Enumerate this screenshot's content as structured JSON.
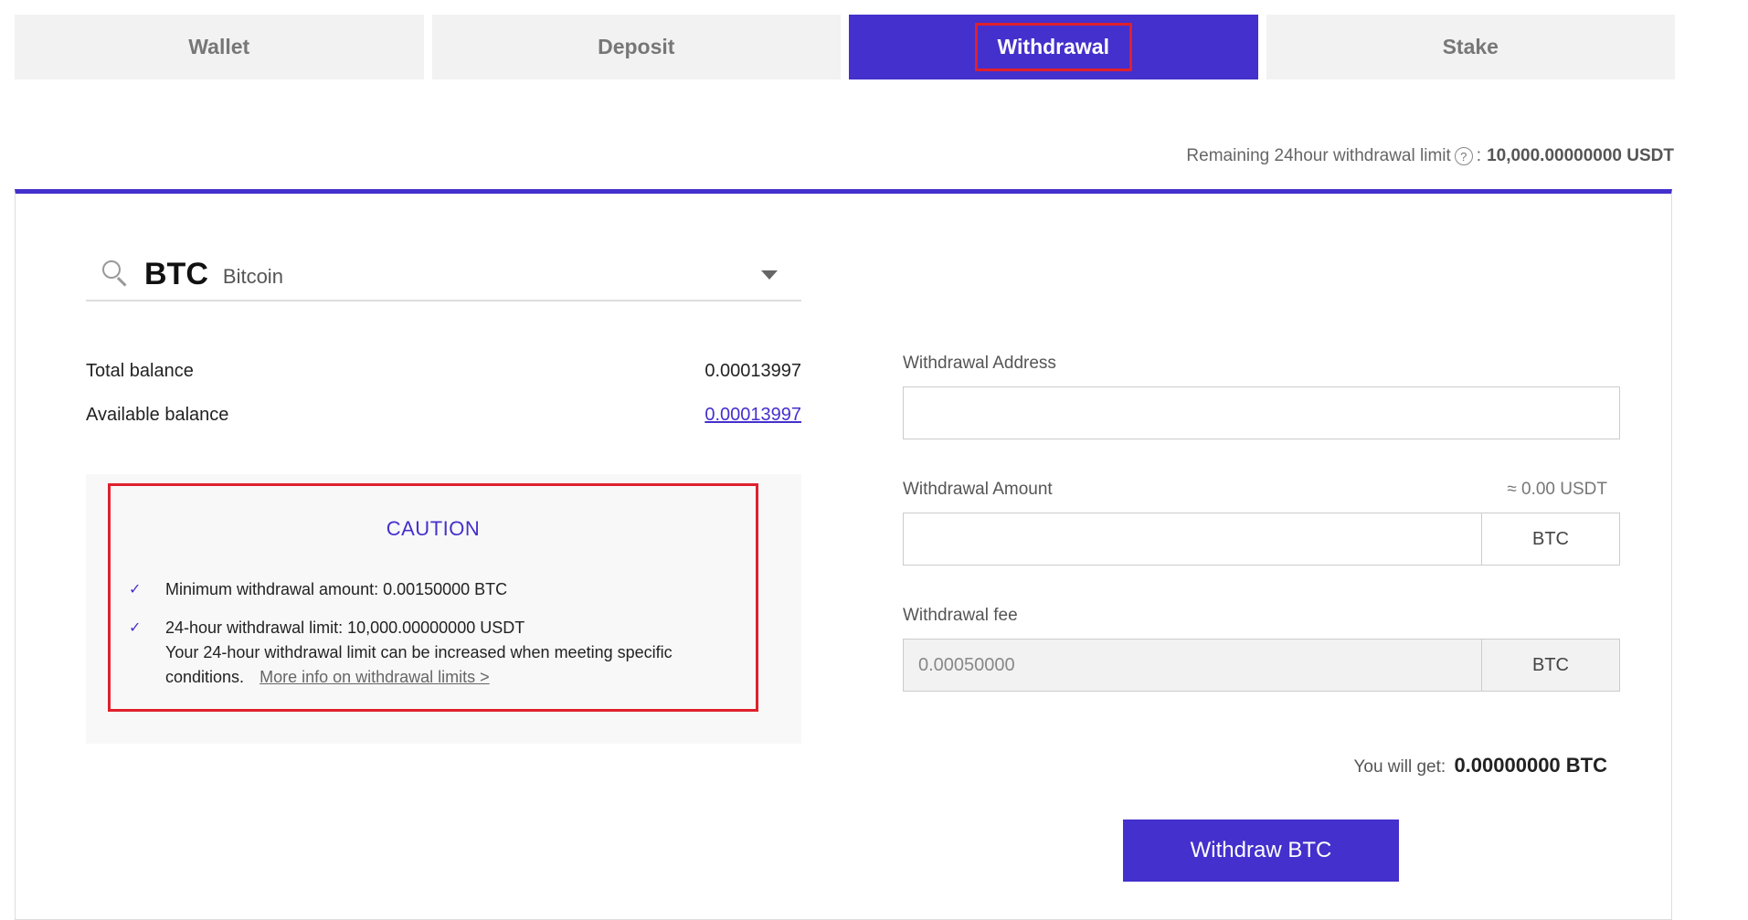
{
  "tabs": [
    {
      "label": "Wallet"
    },
    {
      "label": "Deposit"
    },
    {
      "label": "Withdrawal",
      "active": true
    },
    {
      "label": "Stake"
    }
  ],
  "limit": {
    "label": "Remaining 24hour withdrawal limit",
    "separator": ":",
    "value": "10,000.00000000 USDT"
  },
  "coin": {
    "symbol": "BTC",
    "name": "Bitcoin"
  },
  "balances": {
    "total_label": "Total balance",
    "total_value": "0.00013997",
    "available_label": "Available balance",
    "available_value": "0.00013997"
  },
  "caution": {
    "title": "CAUTION",
    "item1": "Minimum withdrawal amount: 0.00150000 BTC",
    "item2_line1": "24-hour withdrawal limit: 10,000.00000000 USDT",
    "item2_line2": "Your 24-hour withdrawal limit can be increased when meeting specific conditions.",
    "more_link": "More info on withdrawal limits >"
  },
  "form": {
    "address_label": "Withdrawal Address",
    "address_value": "",
    "amount_label": "Withdrawal Amount",
    "amount_approx": "≈ 0.00 USDT",
    "amount_value": "",
    "amount_unit": "BTC",
    "fee_label": "Withdrawal fee",
    "fee_value": "0.00050000",
    "fee_unit": "BTC",
    "you_get_label": "You will get:",
    "you_get_value": "0.00000000 BTC",
    "submit_label": "Withdraw BTC"
  },
  "colors": {
    "accent": "#4430cc",
    "highlight": "#e0202c"
  }
}
